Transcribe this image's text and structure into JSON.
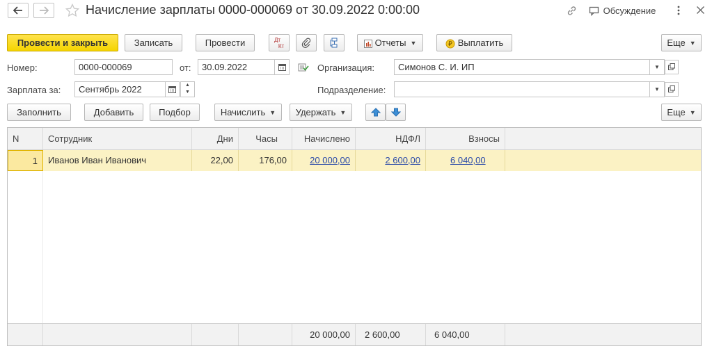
{
  "window": {
    "title": "Начисление зарплаты 0000-000069 от 30.09.2022 0:00:00",
    "discussion_label": "Обсуждение",
    "back_icon": "arrow-left-icon",
    "forward_icon": "arrow-right-icon",
    "star_icon": "star-icon",
    "link_icon": "link-icon",
    "chat_icon": "chat-icon",
    "more_icon": "more-vertical-icon",
    "close_icon": "close-icon"
  },
  "toolbar": {
    "post_close_label": "Провести и закрыть",
    "save_label": "Записать",
    "post_label": "Провести",
    "dtkt_top": "Дт",
    "dtkt_bottom": "Кт",
    "reports_label": "Отчеты",
    "pay_label": "Выплатить",
    "more_label": "Еще",
    "accent_color": "#f5d400"
  },
  "form": {
    "number_label": "Номер:",
    "number_value": "0000-000069",
    "date_label": "от:",
    "date_value": "30.09.2022",
    "org_label": "Организация:",
    "org_value": "Симонов С. И. ИП",
    "salary_for_label": "Зарплата за:",
    "salary_for_value": "Сентябрь 2022",
    "division_label": "Подразделение:",
    "division_value": ""
  },
  "table_toolbar": {
    "fill_label": "Заполнить",
    "add_label": "Добавить",
    "pick_label": "Подбор",
    "accrue_label": "Начислить",
    "withhold_label": "Удержать",
    "more_label": "Еще"
  },
  "table": {
    "headers": [
      "N",
      "Сотрудник",
      "Дни",
      "Часы",
      "Начислено",
      "НДФЛ",
      "Взносы"
    ],
    "rows": [
      {
        "n": "1",
        "employee": "Иванов Иван Иванович",
        "days": "22,00",
        "hours": "176,00",
        "accrued": "20 000,00",
        "ndfl": "2 600,00",
        "contrib": "6 040,00"
      }
    ],
    "totals": {
      "accrued": "20 000,00",
      "ndfl": "2 600,00",
      "contrib": "6 040,00"
    },
    "selected_row_color": "#fbf2c4"
  }
}
